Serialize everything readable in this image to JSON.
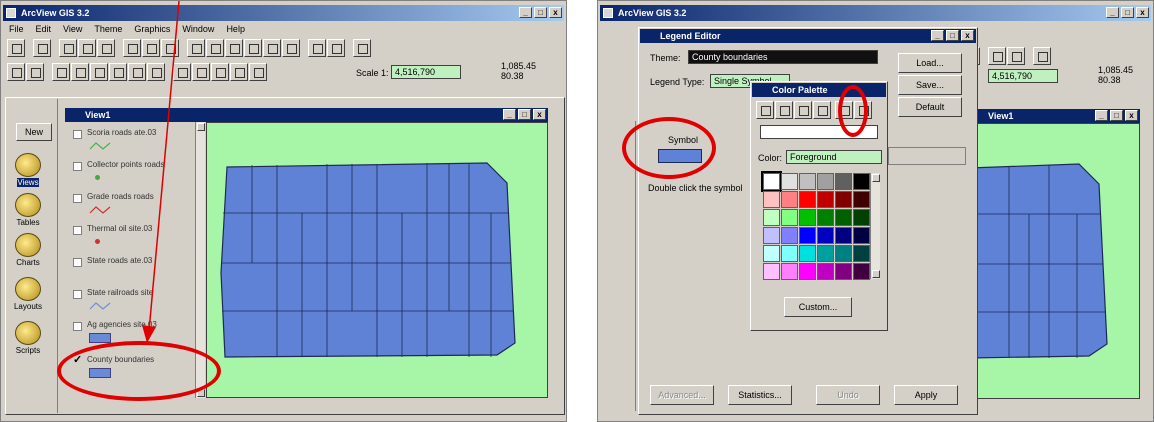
{
  "left": {
    "app_title": "ArcView GIS 3.2",
    "menu": [
      "File",
      "Edit",
      "View",
      "Theme",
      "Graphics",
      "Window",
      "Help"
    ],
    "scale_label": "Scale 1:",
    "scale_value": "4,516,790",
    "coords": [
      "1,085.45",
      "80.38"
    ],
    "view_title": "View1",
    "project_items": [
      "Views",
      "Tables",
      "Charts",
      "Layouts",
      "Scripts"
    ],
    "new_button": "New",
    "themes": [
      {
        "label": "Scoria roads ate.03",
        "checked": false,
        "symbol": "line-green"
      },
      {
        "label": "Collector points roads",
        "checked": false,
        "symbol": "dot-green"
      },
      {
        "label": "Grade roads roads",
        "checked": false,
        "symbol": "line-red"
      },
      {
        "label": "Thermal oil site.03",
        "checked": false,
        "symbol": "dot-red"
      },
      {
        "label": "State roads ate.03",
        "checked": false,
        "symbol": "none"
      },
      {
        "label": "State railroads site",
        "checked": false,
        "symbol": "line-blue"
      },
      {
        "label": "Ag agencies site.03",
        "checked": false,
        "symbol": "poly-blue"
      },
      {
        "label": "County boundaries",
        "checked": true,
        "symbol": "poly-blue"
      }
    ],
    "colors": {
      "map_bg": "#a7f5a7",
      "county_fill": "#5f82d6",
      "highlight": "#e00000"
    }
  },
  "right": {
    "app_title": "ArcView GIS 3.2",
    "legend_editor_title": "Legend Editor",
    "theme_label": "Theme:",
    "theme_value": "County boundaries",
    "legend_type_label": "Legend Type:",
    "legend_type_value": "Single Symbol",
    "buttons": {
      "load": "Load...",
      "save": "Save...",
      "default": "Default"
    },
    "symbol_label": "Symbol",
    "hint_text": "Double click the symbol",
    "palette_title": "Color Palette",
    "color_label": "Color:",
    "color_value": "Foreground",
    "custom_button": "Custom...",
    "bottom_buttons": {
      "advanced": "Advanced...",
      "statistics": "Statistics...",
      "undo": "Undo",
      "apply": "Apply"
    },
    "view_title": "View1",
    "scale_value": "4,516,790",
    "coords": [
      "1,085.45",
      "80.38"
    ],
    "swatch_colors": [
      "#ffffff",
      "#e0e0e0",
      "#c0c0c0",
      "#a0a0a0",
      "#606060",
      "#000000",
      "#ffc0c0",
      "#ff8080",
      "#ff0000",
      "#c00000",
      "#800000",
      "#400000",
      "#c0ffc0",
      "#80ff80",
      "#00c000",
      "#008000",
      "#006000",
      "#004000",
      "#c0c0ff",
      "#8080ff",
      "#0000ff",
      "#0000c0",
      "#000080",
      "#000040",
      "#c0ffff",
      "#80ffff",
      "#00e0e0",
      "#00a0a0",
      "#008080",
      "#004040",
      "#ffc0ff",
      "#ff80ff",
      "#ff00ff",
      "#c000c0",
      "#800080",
      "#400040"
    ]
  }
}
